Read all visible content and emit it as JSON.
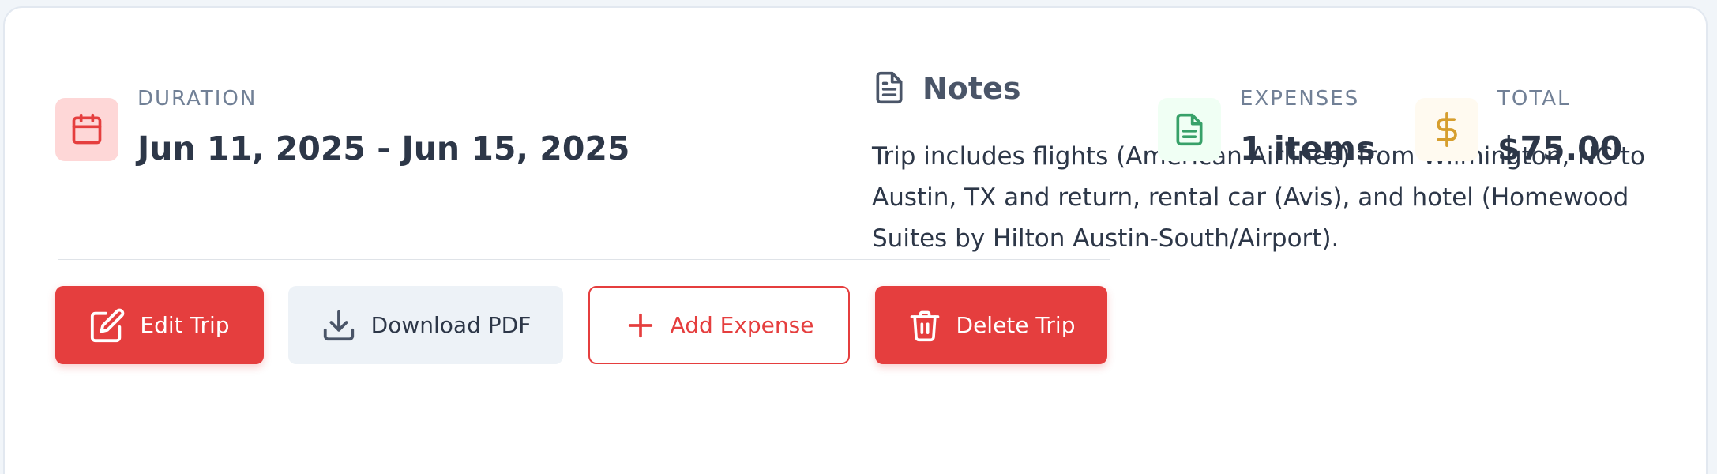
{
  "stats": {
    "duration": {
      "label": "DURATION",
      "value": "Jun 11, 2025 - Jun 15, 2025",
      "icon": "calendar-icon",
      "color": "#e53e3e",
      "bg": "#fed7d7"
    },
    "expenses": {
      "label": "EXPENSES",
      "value": "1 items",
      "icon": "document-icon",
      "color": "#38a169",
      "bg": "#f0fff4"
    },
    "total": {
      "label": "TOTAL",
      "value": "$75.00",
      "icon": "dollar-icon",
      "color": "#d69e2e",
      "bg": "#fffaf0"
    }
  },
  "notes": {
    "title": "Notes",
    "text": "Trip includes flights (American Airlines) from Wilmington, NC to Austin, TX and return, rental car (Avis), and hotel (Homewood Suites by Hilton Austin-South/Airport)."
  },
  "actions": {
    "edit": "Edit Trip",
    "download": "Download PDF",
    "add_expense": "Add Expense",
    "delete": "Delete Trip"
  },
  "colors": {
    "accent": "#e53e3e",
    "text": "#2d3748",
    "muted": "#718096"
  }
}
